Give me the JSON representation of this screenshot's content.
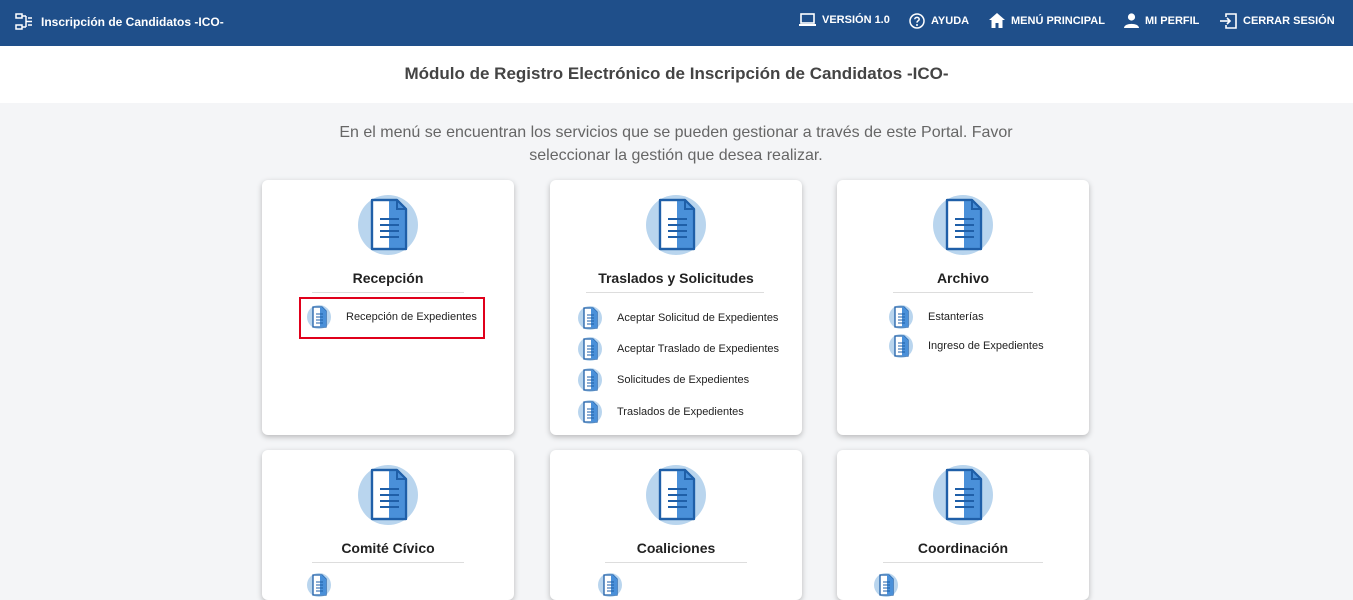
{
  "app": {
    "title": "Inscripción de Candidatos -ICO-"
  },
  "nav": {
    "version": "VERSIÓN 1.0",
    "help": "AYUDA",
    "main_menu": "MENÚ PRINCIPAL",
    "profile": "MI PERFIL",
    "logout": "CERRAR SESIÓN"
  },
  "page": {
    "title": "Módulo de Registro Electrónico de Inscripción de Candidatos -ICO-",
    "intro_line1": "En el menú se encuentran los servicios que se pueden gestionar a través de este Portal. Favor",
    "intro_line2": "seleccionar la gestión que desea realizar."
  },
  "cards": [
    {
      "title": "Recepción",
      "items": [
        "Recepción de Expedientes"
      ]
    },
    {
      "title": "Traslados y Solicitudes",
      "items": [
        "Aceptar Solicitud de Expedientes",
        "Aceptar Traslado de Expedientes",
        "Solicitudes de Expedientes",
        "Traslados de Expedientes"
      ]
    },
    {
      "title": "Archivo",
      "items": [
        "Estanterías",
        "Ingreso de Expedientes"
      ]
    },
    {
      "title": "Comité Cívico",
      "items": []
    },
    {
      "title": "Coaliciones",
      "items": []
    },
    {
      "title": "Coordinación",
      "items": []
    }
  ],
  "colors": {
    "topbar": "#1f4f8a",
    "icon_circle": "#b9d5ee",
    "icon_doc": "#4a90d9",
    "highlight": "#e0001b"
  },
  "icons": {
    "brand": "tree-structure-icon",
    "version": "laptop-icon",
    "help": "help-circle-icon",
    "main_menu": "home-icon",
    "profile": "user-icon",
    "logout": "logout-icon",
    "card": "document-icon",
    "item": "document-icon"
  }
}
